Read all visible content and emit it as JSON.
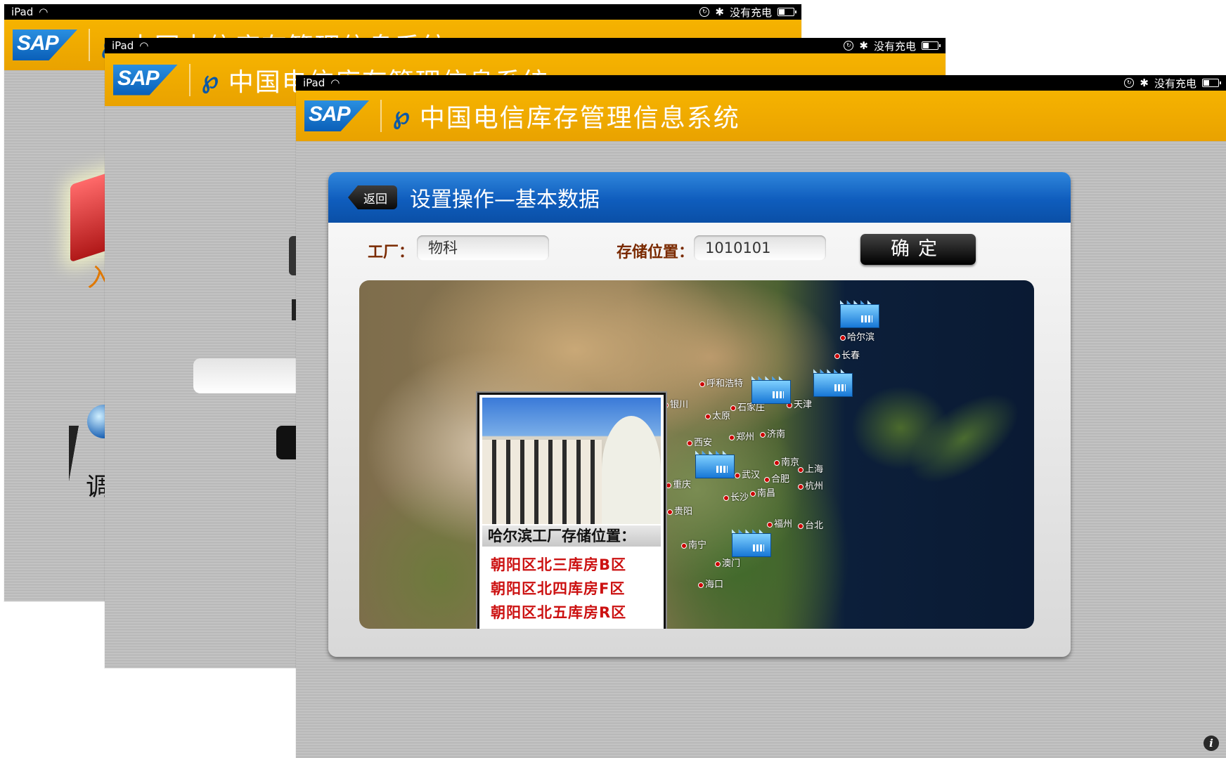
{
  "status_bar": {
    "device": "iPad",
    "charge_text": "没有充电"
  },
  "header": {
    "sap_logo": "SAP",
    "telecom_logo_glyph": "ᔕ",
    "title": "中国电信库存管理信息系统"
  },
  "screen1": {
    "fragment_char_top": "入",
    "fragment_char_bottom": "调"
  },
  "panel": {
    "back_label": "返回",
    "title": "设置操作—基本数据"
  },
  "form": {
    "plant_label": "工厂：",
    "plant_value": "物科",
    "location_label": "存储位置：",
    "location_value": "1010101",
    "confirm_label": "确定"
  },
  "map": {
    "cities": [
      "哈尔滨",
      "长春",
      "呼和浩特",
      "银川",
      "太原",
      "石家庄",
      "天津",
      "西安",
      "郑州",
      "济南",
      "南京",
      "上海",
      "武汉",
      "合肥",
      "杭州",
      "重庆",
      "长沙",
      "南昌",
      "贵阳",
      "福州",
      "台北",
      "南宁",
      "澳门",
      "海口"
    ],
    "popup": {
      "title": "哈尔滨工厂存储位置：",
      "items": [
        "朝阳区北三库房B区",
        "朝阳区北四库房F区",
        "朝阳区北五库房R区"
      ]
    }
  },
  "icons": {
    "wifi": "wifi-icon",
    "orientation_lock": "orientation-lock-icon",
    "bluetooth": "bluetooth-icon",
    "battery": "battery-icon",
    "factory": "factory-icon",
    "info": "info-icon"
  },
  "colors": {
    "header_orange": "#F2AC00",
    "panel_blue": "#0F5DBD",
    "popup_red": "#CC1111"
  }
}
